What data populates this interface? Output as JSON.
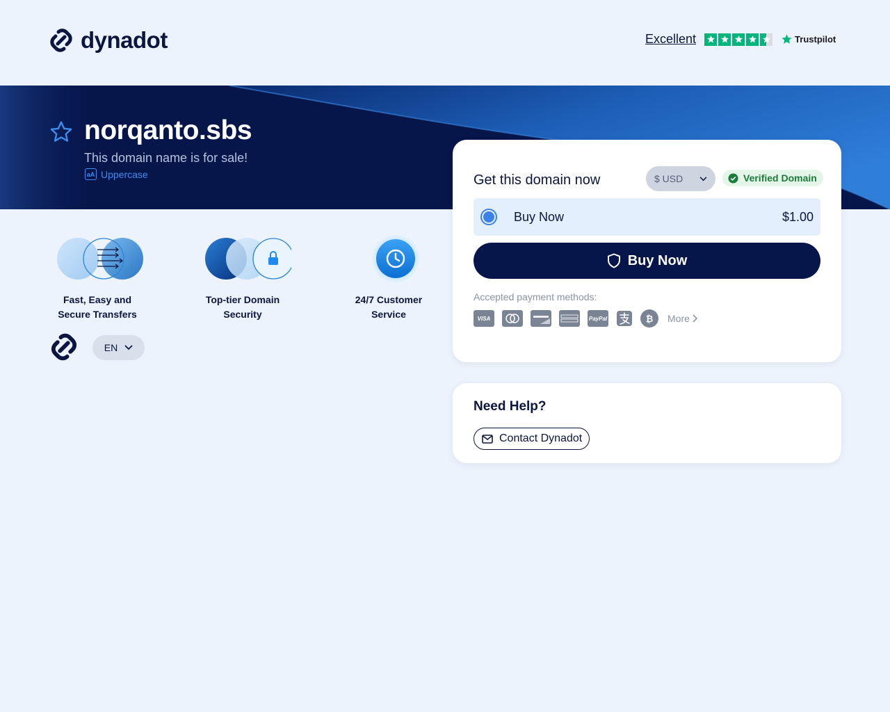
{
  "header": {
    "logo_text": "dynadot",
    "trust_label": "Excellent",
    "trust_rating": 4.5,
    "trust_brand": "Trustpilot"
  },
  "hero": {
    "domain": "norqanto.sbs",
    "subtitle": "This domain name is for sale!",
    "uppercase_label": "Uppercase",
    "uppercase_badge": "aA"
  },
  "features": [
    {
      "label_line1": "Fast, Easy and",
      "label_line2": "Secure Transfers"
    },
    {
      "label_line1": "Top-tier Domain",
      "label_line2": "Security"
    },
    {
      "label_line1": "24/7 Customer",
      "label_line2": "Service"
    }
  ],
  "language": {
    "selected": "EN"
  },
  "purchase": {
    "title": "Get this domain now",
    "currency": "$ USD",
    "verified_label": "Verified Domain",
    "option_label": "Buy Now",
    "option_price": "$1.00",
    "buy_button": "Buy Now",
    "payment_label": "Accepted payment methods:",
    "payment_methods": [
      "VISA",
      "Mastercard",
      "DISCOVER",
      "AMERICAN EXPRESS",
      "PayPal",
      "Alipay",
      "Bitcoin"
    ],
    "visa_text": "VISA",
    "paypal_text": "PayPal",
    "bitcoin_text": "₿",
    "more_label": "More"
  },
  "help": {
    "title": "Need Help?",
    "contact_label": "Contact Dynadot"
  },
  "colors": {
    "navy": "#06154a",
    "accent_blue": "#3b82e8",
    "verified_green": "#1c7a3a",
    "trustpilot_green": "#00b67a",
    "background": "#edf3fc"
  }
}
